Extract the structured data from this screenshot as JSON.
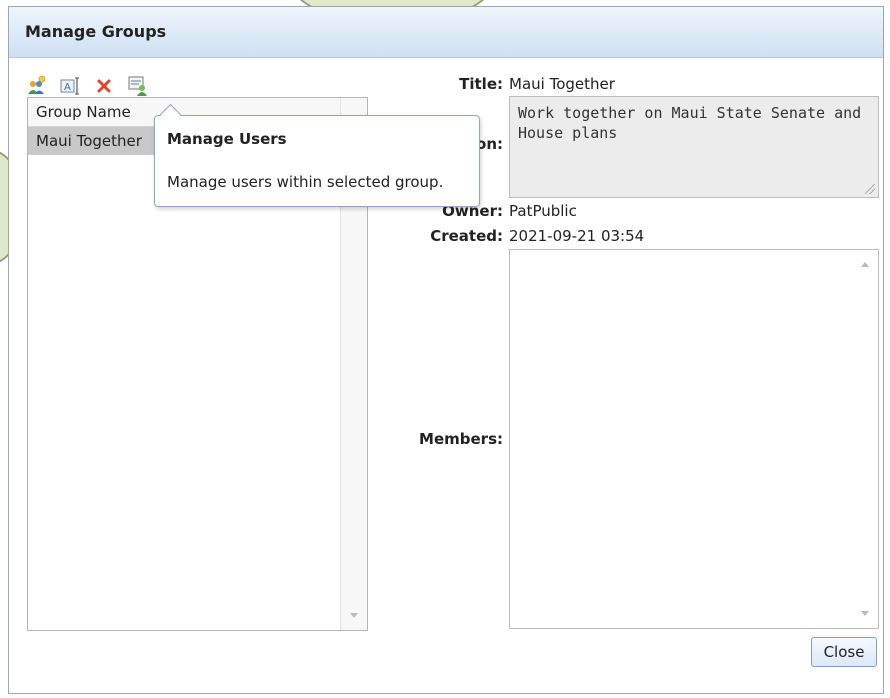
{
  "dialog": {
    "title": "Manage Groups"
  },
  "toolbar": {
    "buttons": [
      {
        "icon": "add-group-icon"
      },
      {
        "icon": "rename-group-icon"
      },
      {
        "icon": "delete-group-icon"
      },
      {
        "icon": "manage-users-icon"
      }
    ]
  },
  "group_list": {
    "header": "Group Name",
    "rows": [
      "Maui Together"
    ]
  },
  "tooltip": {
    "title": "Manage Users",
    "body": "Manage users within selected group."
  },
  "details": {
    "title_label": "Title:",
    "title_value": "Maui Together",
    "description_label_visible": "ion:",
    "description_value": "Work together on Maui State Senate and House plans",
    "owner_label": "Owner:",
    "owner_value": "PatPublic",
    "created_label": "Created:",
    "created_value": "2021-09-21 03:54",
    "members_label": "Members:"
  },
  "buttons": {
    "close": "Close"
  },
  "colors": {
    "titlebar": "#cfe0f2",
    "selected_row": "#c8c8c8",
    "delete_icon": "#e0442a"
  }
}
